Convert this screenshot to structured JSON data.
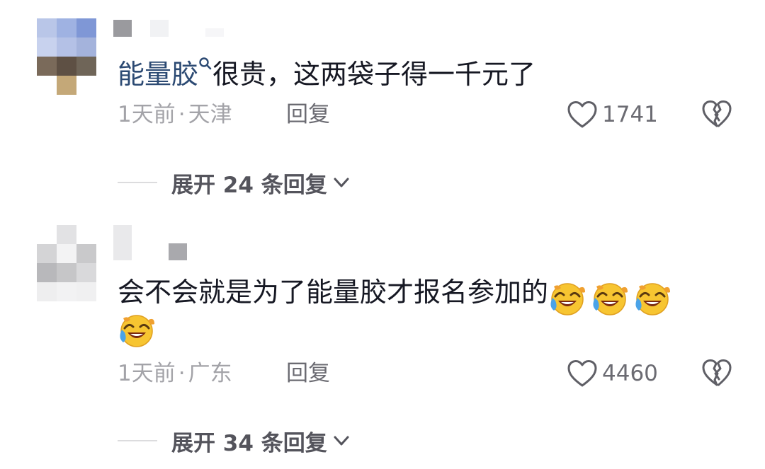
{
  "comments": [
    {
      "keyword": "能量胶",
      "text": "很贵，这两袋子得一千元了",
      "time": "1天前",
      "separator": "·",
      "location": "天津",
      "reply_label": "回复",
      "likes": "1741",
      "expand_label": "展开 24 条回复"
    },
    {
      "keyword": "",
      "text": "会不会就是为了能量胶才报名参加的",
      "emojis": [
        "laughing-crying-emoji",
        "laughing-crying-emoji",
        "laughing-crying-emoji",
        "laughing-crying-emoji"
      ],
      "time": "1天前",
      "separator": "·",
      "location": "广东",
      "reply_label": "回复",
      "likes": "4460",
      "expand_label": "展开 34 条回复"
    }
  ],
  "colors": {
    "text_primary": "#161823",
    "text_secondary": "#a3a3a8",
    "link": "#2c4a73",
    "action": "#6b6b72",
    "expand": "#54545c"
  },
  "icons": [
    "search-icon",
    "heart-outline-icon",
    "broken-heart-icon",
    "chevron-down-icon",
    "laughing-crying-emoji"
  ]
}
